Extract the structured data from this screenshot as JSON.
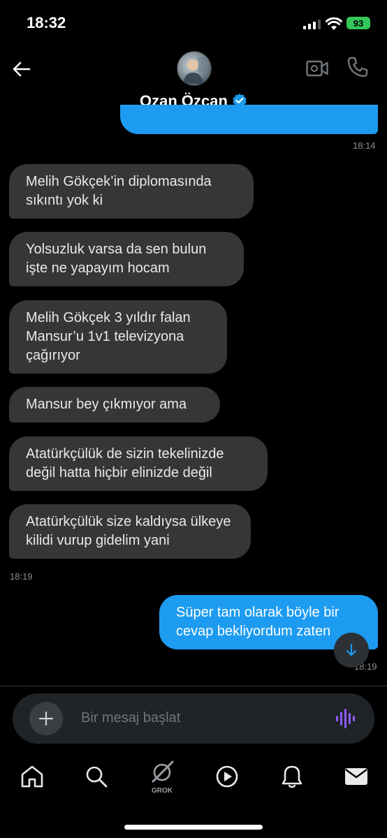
{
  "status_bar": {
    "time": "18:32",
    "battery": "93"
  },
  "header": {
    "contact_name": "Ozan Özcan"
  },
  "messages": [
    {
      "text": "Melih Gökçek’in diplomasında sıkıntı yok ki"
    },
    {
      "text": "Yolsuzluk varsa da sen bulun işte ne yapayım hocam"
    },
    {
      "text": "Melih Gökçek 3 yıldır falan Mansur’u 1v1 televizyona çağırıyor"
    },
    {
      "text": "Mansur bey çıkmıyor ama"
    },
    {
      "text": "Atatürkçülük de sizin tekelinizde değil hatta hiçbir elinizde değil"
    },
    {
      "text": "Atatürkçülük size kaldıysa ülkeye kilidi vurup gidelim yani"
    }
  ],
  "sent_message": {
    "text": "Süper tam olarak böyle bir cevap bekliyordum zaten"
  },
  "timestamps": {
    "top_sent": "18:14",
    "received": "18:19",
    "last_sent": "18:19"
  },
  "composer": {
    "placeholder": "Bir mesaj başlat"
  },
  "bottom_nav": {
    "grok_label": "GROK"
  },
  "colors": {
    "accent": "#1d9bf0",
    "bubble_received": "#343638",
    "voice_purple": "#8b5cf6"
  }
}
